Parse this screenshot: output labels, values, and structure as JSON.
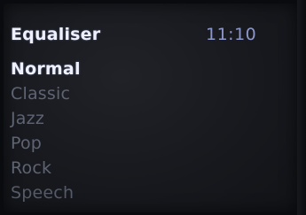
{
  "header": {
    "title": "Equaliser",
    "time": "11:10"
  },
  "menu": {
    "items": [
      {
        "label": "Normal",
        "selected": true
      },
      {
        "label": "Classic",
        "selected": false
      },
      {
        "label": "Jazz",
        "selected": false
      },
      {
        "label": "Pop",
        "selected": false
      },
      {
        "label": "Rock",
        "selected": false
      },
      {
        "label": "Speech",
        "selected": false
      }
    ]
  },
  "colors": {
    "highlight_text": "#eef0ff",
    "normal_text": "#5f6473",
    "clock_text": "#8e97c9",
    "background": "#17191e"
  }
}
